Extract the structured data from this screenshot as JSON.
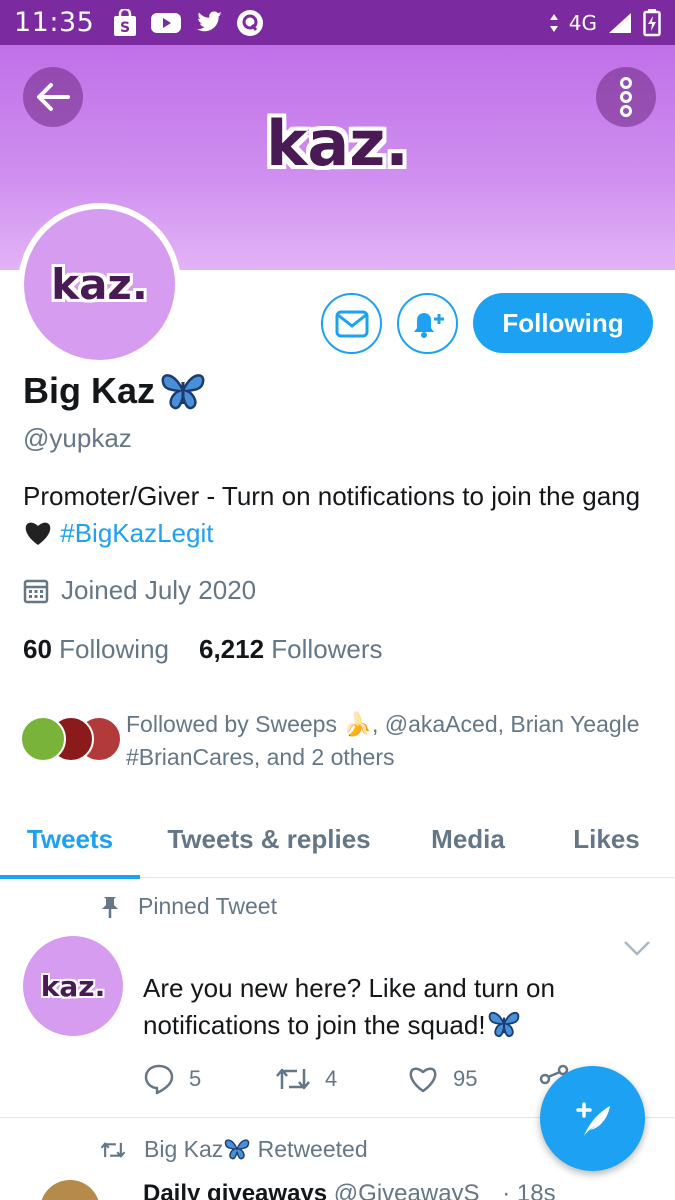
{
  "status_bar": {
    "time": "11:35",
    "network": "4G",
    "icons": [
      "shopping-bag-icon",
      "youtube-icon",
      "twitter-icon",
      "quora-icon",
      "signal-icon",
      "battery-icon"
    ]
  },
  "banner": {
    "logo_text": "kaz."
  },
  "profile": {
    "avatar_text": "kaz.",
    "name": "Big Kaz",
    "handle": "@yupkaz",
    "bio_text": "Promoter/Giver - Turn on notifications to join the gang",
    "bio_hashtag": "#BigKazLegit",
    "joined": "Joined July 2020",
    "following_count": "60",
    "following_label": "Following",
    "followers_count": "6,212",
    "followers_label": "Followers",
    "followed_by": "Followed by Sweeps 🍌, @akaAced, Brian Yeagle #BrianCares, and 2 others"
  },
  "actions": {
    "following_button": "Following"
  },
  "tabs": [
    {
      "label": "Tweets",
      "active": true
    },
    {
      "label": "Tweets & replies",
      "active": false
    },
    {
      "label": "Media",
      "active": false
    },
    {
      "label": "Likes",
      "active": false
    }
  ],
  "pinned_tweet": {
    "pinned_label": "Pinned Tweet",
    "avatar_text": "kaz.",
    "text": "Are you new here? Like and turn on notifications to join the squad!",
    "replies": "5",
    "retweets": "4",
    "likes": "95"
  },
  "next_tweet": {
    "retweeted_label": "Retweeted",
    "retweeter": "Big Kaz",
    "author": "Daily giveaways",
    "handle": "@GiveawayS",
    "time": "· 18s"
  },
  "colors": {
    "accent": "#1da1f2",
    "status_bar": "#7b2aa0",
    "banner": "#c070e8"
  }
}
